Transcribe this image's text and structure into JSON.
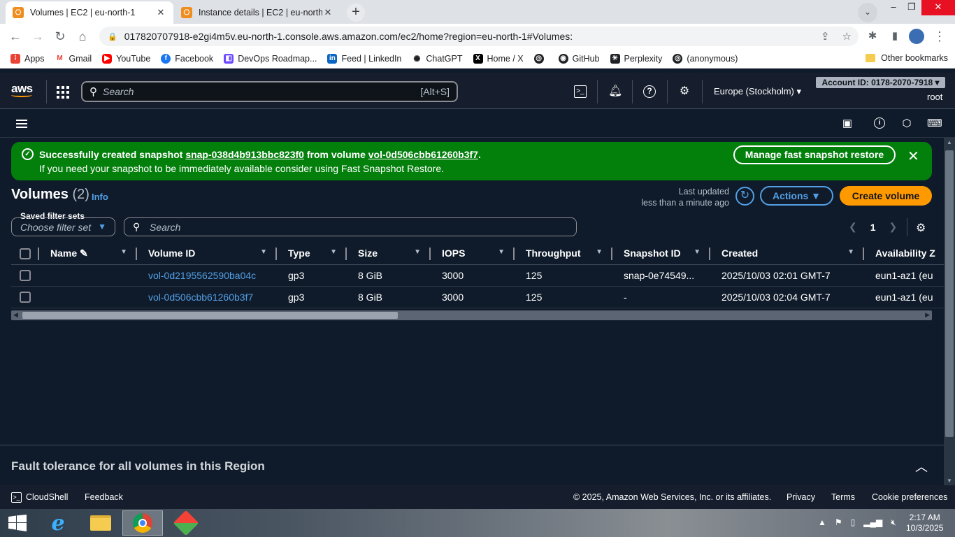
{
  "browser": {
    "tabs": [
      {
        "title": "Volumes | EC2 | eu-north-1",
        "active": true
      },
      {
        "title": "Instance details | EC2 | eu-north-",
        "active": false
      }
    ],
    "url": "017820707918-e2gi4m5v.eu-north-1.console.aws.amazon.com/ec2/home?region=eu-north-1#Volumes:",
    "bookmarks": [
      "Apps",
      "Gmail",
      "YouTube",
      "Facebook",
      "DevOps Roadmap...",
      "Feed | LinkedIn",
      "ChatGPT",
      "Home / X",
      "",
      "GitHub",
      "Perplexity",
      "(anonymous)"
    ],
    "other_bookmarks": "Other bookmarks"
  },
  "aws": {
    "logo": "aws",
    "search_placeholder": "Search",
    "search_shortcut": "[Alt+S]",
    "region": "Europe (Stockholm) ▾",
    "account": "Account ID: 0178-2070-7918 ▾",
    "user": "root"
  },
  "flash": {
    "prefix": "Successfully created snapshot ",
    "snapshot": "snap-038d4b913bbc823f0",
    "middle": " from volume ",
    "volume": "vol-0d506cbb61260b3f7",
    "suffix": ".",
    "line2": "If you need your snapshot to be immediately available consider using Fast Snapshot Restore.",
    "button": "Manage fast snapshot restore"
  },
  "volumes": {
    "title": "Volumes",
    "count": "(2)",
    "info": "Info",
    "last_updated_1": "Last updated",
    "last_updated_2": "less than a minute ago",
    "actions": "Actions ▼",
    "create": "Create volume",
    "saved_filter_label": "Saved filter sets",
    "saved_filter_placeholder": "Choose filter set",
    "search_placeholder": "Search",
    "page": "1",
    "columns": [
      "Name",
      "Volume ID",
      "Type",
      "Size",
      "IOPS",
      "Throughput",
      "Snapshot ID",
      "Created",
      "Availability Z"
    ],
    "rows": [
      [
        "",
        "vol-0d2195562590ba04c",
        "gp3",
        "8 GiB",
        "3000",
        "125",
        "snap-0e74549...",
        "2025/10/03 02:01 GMT-7",
        "eun1-az1 (eu"
      ],
      [
        "",
        "vol-0d506cbb61260b3f7",
        "gp3",
        "8 GiB",
        "3000",
        "125",
        "-",
        "2025/10/03 02:04 GMT-7",
        "eun1-az1 (eu"
      ]
    ]
  },
  "fault_tolerance": "Fault tolerance for all volumes in this Region",
  "footer": {
    "cloudshell": "CloudShell",
    "feedback": "Feedback",
    "copyright": "© 2025, Amazon Web Services, Inc. or its affiliates.",
    "privacy": "Privacy",
    "terms": "Terms",
    "cookie": "Cookie preferences"
  },
  "taskbar": {
    "time": "2:17 AM",
    "date": "10/3/2025"
  }
}
